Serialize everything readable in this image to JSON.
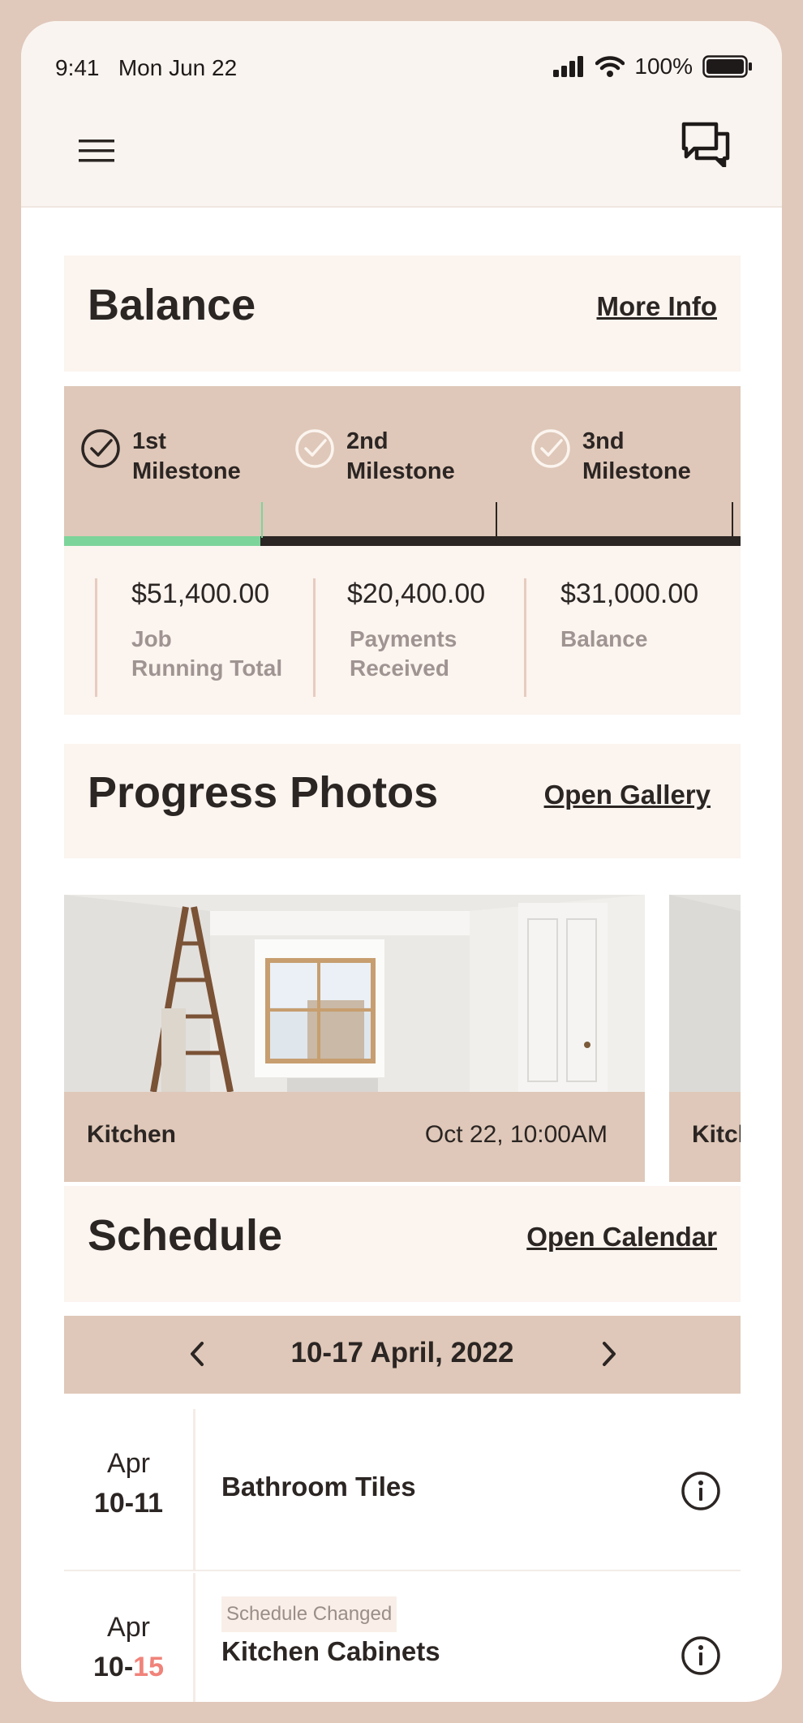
{
  "status_bar": {
    "time": "9:41",
    "date": "Mon Jun 22",
    "battery": "100%"
  },
  "header": {
    "menu_icon": "hamburger-menu-icon",
    "chat_icon": "chat-bubbles-icon"
  },
  "balance": {
    "title": "Balance",
    "link": "More Info",
    "progress": 0.29,
    "milestones": [
      {
        "line1": "1st",
        "line2": "Milestone",
        "completed": true
      },
      {
        "line1": "2nd",
        "line2": "Milestone",
        "completed": false
      },
      {
        "line1": "3nd",
        "line2": "Milestone",
        "completed": false
      }
    ],
    "totals": [
      {
        "value": "$51,400.00",
        "line1": "Job",
        "line2": "Running Total"
      },
      {
        "value": "$20,400.00",
        "line1": "Payments",
        "line2": "Received"
      },
      {
        "value": "$31,000.00",
        "line1": "Balance",
        "line2": ""
      }
    ]
  },
  "photos": {
    "title": "Progress Photos",
    "link": "Open Gallery",
    "items": [
      {
        "title": "Kitchen",
        "date": "Oct 22, 10:00AM"
      },
      {
        "title": "Kitchen",
        "date": ""
      }
    ]
  },
  "schedule": {
    "title": "Schedule",
    "link": "Open Calendar",
    "week_label": "10-17 April, 2022",
    "items": [
      {
        "month": "Apr",
        "day_start": "10-",
        "day_end": "11",
        "title": "Bathroom Tiles",
        "badge": ""
      },
      {
        "month": "Apr",
        "day_start": "10-",
        "day_end": "15",
        "title": "Kitchen Cabinets",
        "badge": "Schedule Changed"
      }
    ]
  },
  "colors": {
    "accent_green": "#7dd49a",
    "tan": "#dfc8b9",
    "cream": "#fbf4ef",
    "changed_red": "#f0837a"
  }
}
